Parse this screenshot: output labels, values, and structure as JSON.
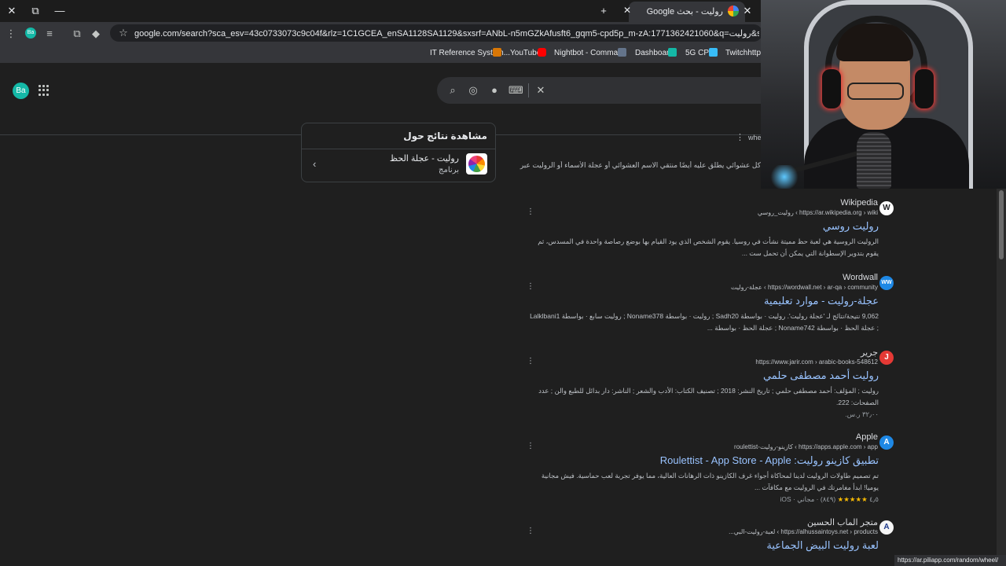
{
  "browser": {
    "window_controls": {
      "close": "✕",
      "restore": "⧉",
      "minimize": "—"
    },
    "new_tab": "+",
    "tab": {
      "title": "روليت - بحث Google",
      "close": "✕"
    },
    "other_tab_close": "✕",
    "url": "google.com/search?sca_esv=43c0733073c9c04f&rlz=1C1GCEA_enSA1128SA1129&sxsrf=ANbL-n5mGZkAfusft6_gqm5-cpd5p_m-zA:1771362421060&q=روليت&spell=1&sa=X&ved=2ahUKEwjCx",
    "profile_initials": "Ba",
    "bookmarks": [
      "IT Reference System...",
      "YouTube",
      "Nightbot - Comma...",
      "Dashboard",
      "5G CPE",
      "Twitchhttps://"
    ]
  },
  "google": {
    "avatar_initials": "Ba",
    "about_panel": {
      "heading": "مشاهدة نتائج حول",
      "title": "روليت - عجلة الحظ",
      "subtitle": "برنامج"
    },
    "partial_top": {
      "site": "whe",
      "snippet": "كل عشوائي يطلق عليه أيضًا منتقي الاسم العشوائي أو عجلة الأسماء أو الروليت عبر"
    },
    "results": [
      {
        "site": "Wikipedia",
        "icon": "W",
        "url": "https://ar.wikipedia.org › wiki › روليت_روسي",
        "title": "روليت روسي",
        "snippet": "الروليت الروسية هي لعبة حظ مميتة نشأت في روسيا. يقوم الشخص الذي يود القيام بها بوضع رصاصة واحدة في المسدس، ثم يقوم بتدوير الإسطوانة التي يمكن أن تحمل ست ...",
        "meta": ""
      },
      {
        "site": "Wordwall",
        "icon": "WW",
        "url": "https://wordwall.net › ar-qa › community › عجلة-روليت",
        "title": "عجلة-روليت - موارد تعليمية",
        "snippet": "9,062 نتيجة/نتائج لـ 'عجلة روليت'. روليت · بواسطة Sadh20 ; روليت · بواسطة Noname378 ; روليت سابع · بواسطة Lalklbani1 ; عجلة الحظ · بواسطة Noname742 ; عجلة الحظ · بواسطة ...",
        "meta": ""
      },
      {
        "site": "جرير",
        "icon": "J",
        "url": "https://www.jarir.com › arabic-books-548612",
        "title": "روليت أحمد مصطفى حلمي",
        "snippet": "روليت ; المؤلف: أحمد مصطفى حلمي ; تاريخ النشر: 2018 ; تصنيف الكتاب: الأدب والشعر ; الناشر: دار بدائل للطبع والن ; عدد الصفحات: 222.",
        "meta": "٣٢٫٠٠ ر.س."
      },
      {
        "site": "Apple",
        "icon": "A",
        "url": "https://apps.apple.com › app › كازينو-روليت-roulettist",
        "title": "تطبيق كازينو روليت: Roulettist - App Store - Apple",
        "snippet": "تم تصميم طاولات الروليت لدينا لمحاكاة أجواء غرف الكازينو ذات الرهانات العالية، مما يوفر تجربة لعب حماسية. فيش مجانية يوميا! ابدأ مغامرتك في الروليت مع مكافآت ...",
        "meta_rating": "٤٫٥",
        "meta_stars": "★★★★★",
        "meta": "(٨٤٩) · مجاني · iOS"
      },
      {
        "site": "متجر الماب الحسين",
        "icon": "A",
        "url": "https://alhussaintoys.net › products › لعبة-روليت-البي...",
        "title": "لعبة روليت البيض الجماعية",
        "snippet": "",
        "meta": ""
      }
    ],
    "status_url": "https://ar.piliapp.com/random/wheel/"
  },
  "colors": {
    "page_bg": "#1f1f1f",
    "link": "#99c3ff",
    "accent_teal": "#14b8a6",
    "star": "#fbbc04"
  }
}
